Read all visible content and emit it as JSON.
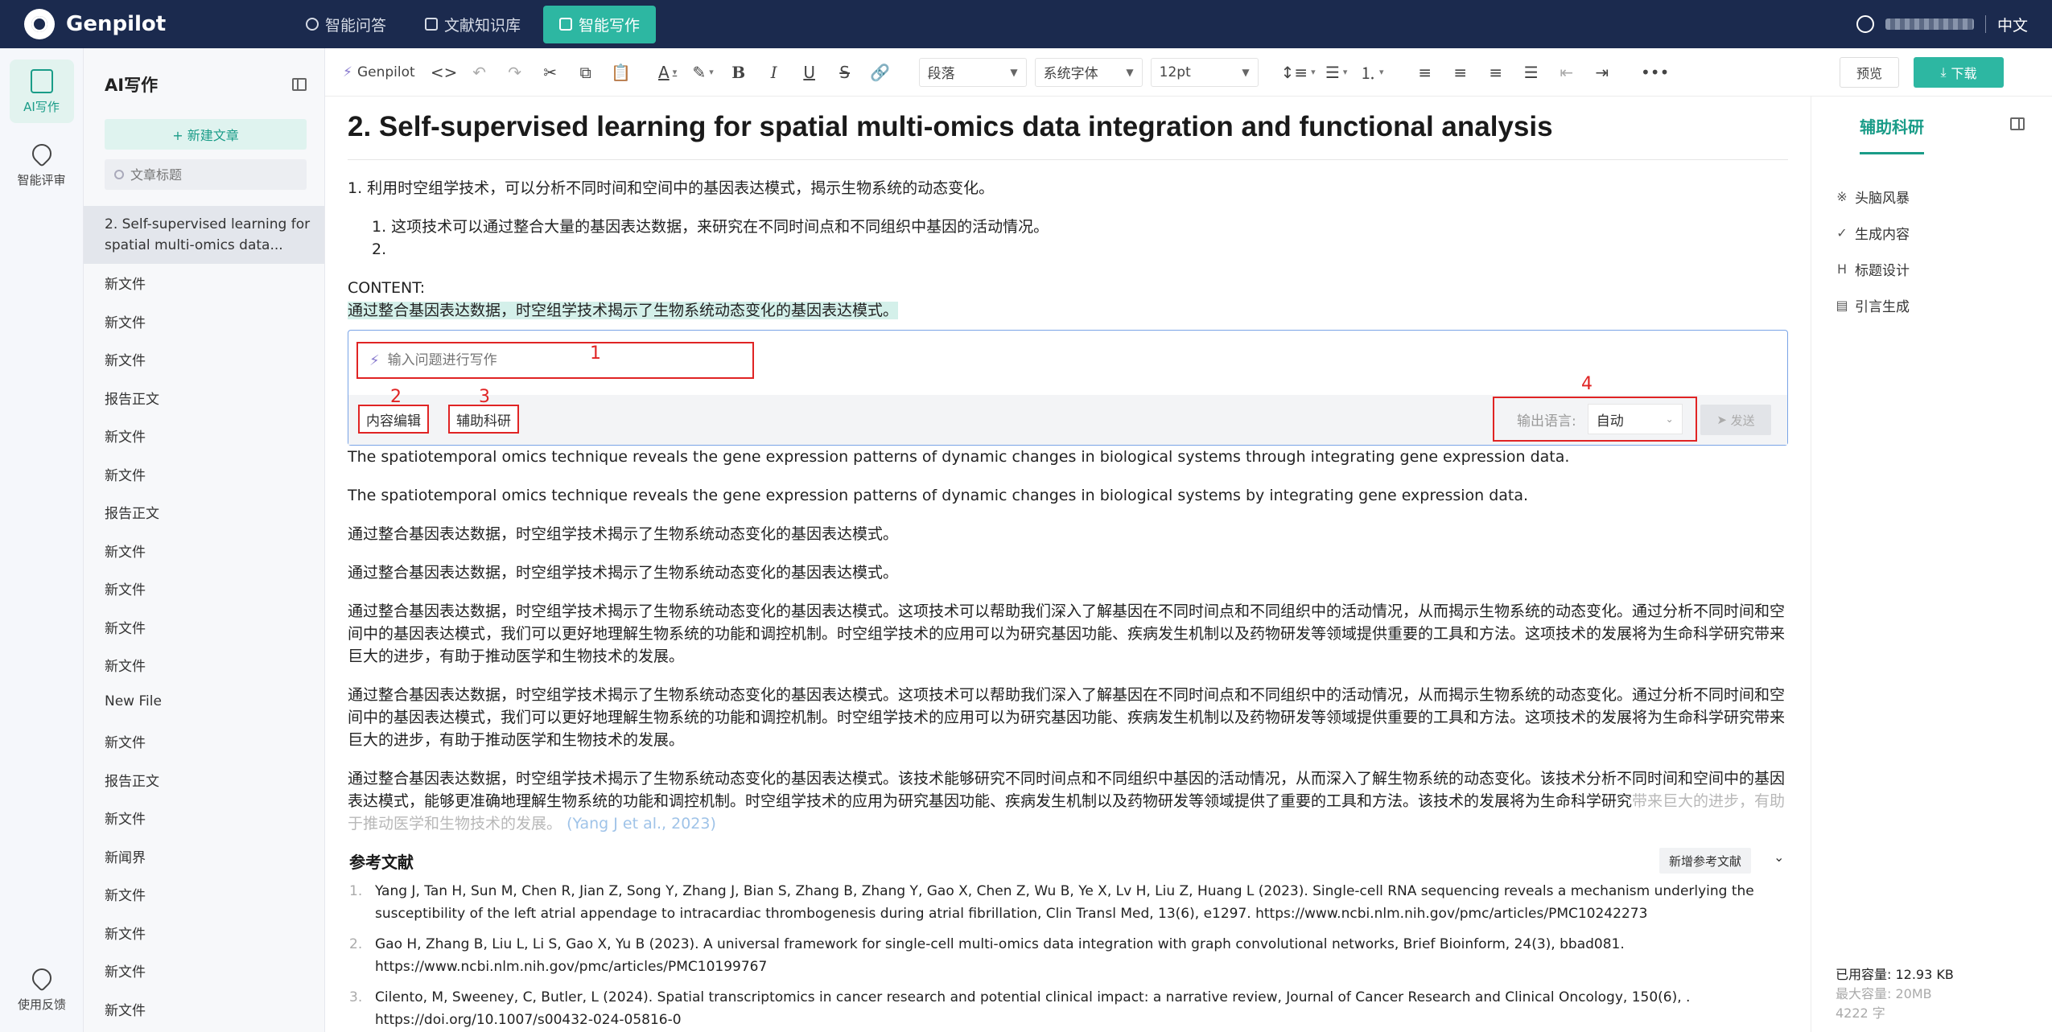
{
  "app": {
    "name": "Genpilot"
  },
  "nav": {
    "tabs": [
      {
        "label": "智能问答"
      },
      {
        "label": "文献知识库"
      },
      {
        "label": "智能写作"
      }
    ],
    "language": "中文"
  },
  "rail": {
    "items": [
      {
        "label": "AI写作"
      },
      {
        "label": "智能评审"
      }
    ],
    "feedback": "使用反馈"
  },
  "docpanel": {
    "title": "AI写作",
    "new_article": "+ 新建文章",
    "search_placeholder": "文章标题",
    "docs": [
      "2. Self-supervised learning for spatial multi-omics data...",
      "新文件",
      "新文件",
      "新文件",
      "报告正文",
      "新文件",
      "新文件",
      "报告正文",
      "新文件",
      "新文件",
      "新文件",
      "新文件",
      "New File",
      "新文件",
      "报告正文",
      "新文件",
      "新闻界",
      "新文件",
      "新文件",
      "新文件",
      "新文件"
    ]
  },
  "toolbar": {
    "genpilot": "Genpilot",
    "paragraph": "段落",
    "font": "系统字体",
    "size": "12pt",
    "preview": "预览",
    "download": "下载"
  },
  "editor": {
    "title": "2. Self-supervised learning for spatial multi-omics data integration and functional analysis",
    "p1": "1. 利用时空组学技术，可以分析不同时间和空间中的基因表达模式，揭示生物系统的动态变化。",
    "p1_sub1": "1. 这项技术可以通过整合大量的基因表达数据，来研究在不同时间点和不同组织中基因的活动情况。",
    "p1_sub2": "2.",
    "content_label": "CONTENT:",
    "highlighted": "通过整合基因表达数据，时空组学技术揭示了生物系统动态变化的基因表达模式。",
    "en1": "The spatiotemporal omics technique reveals the gene expression patterns of dynamic changes in biological systems through integrating gene expression data.",
    "en2": "The spatiotemporal omics technique reveals the gene expression patterns of dynamic changes in biological systems by integrating gene expression data.",
    "zh1": "通过整合基因表达数据，时空组学技术揭示了生物系统动态变化的基因表达模式。",
    "zh2": "通过整合基因表达数据，时空组学技术揭示了生物系统动态变化的基因表达模式。",
    "long1": "通过整合基因表达数据，时空组学技术揭示了生物系统动态变化的基因表达模式。这项技术可以帮助我们深入了解基因在不同时间点和不同组织中的活动情况，从而揭示生物系统的动态变化。通过分析不同时间和空间中的基因表达模式，我们可以更好地理解生物系统的功能和调控机制。时空组学技术的应用可以为研究基因功能、疾病发生机制以及药物研发等领域提供重要的工具和方法。这项技术的发展将为生命科学研究带来巨大的进步，有助于推动医学和生物技术的发展。",
    "long2": "通过整合基因表达数据，时空组学技术揭示了生物系统动态变化的基因表达模式。这项技术可以帮助我们深入了解基因在不同时间点和不同组织中的活动情况，从而揭示生物系统的动态变化。通过分析不同时间和空间中的基因表达模式，我们可以更好地理解生物系统的功能和调控机制。时空组学技术的应用可以为研究基因功能、疾病发生机制以及药物研发等领域提供重要的工具和方法。这项技术的发展将为生命科学研究带来巨大的进步，有助于推动医学和生物技术的发展。",
    "long3": "通过整合基因表达数据，时空组学技术揭示了生物系统动态变化的基因表达模式。该技术能够研究不同时间点和不同组织中基因的活动情况，从而深入了解生物系统的动态变化。该技术分析不同时间和空间中的基因表达模式，能够更准确地理解生物系统的功能和调控机制。时空组学技术的应用为研究基因功能、疾病发生机制以及药物研发等领域提供了重要的工具和方法。该技术的发展将为生命科学研究",
    "long3_faded": "带来巨大的进步，有助于推动医学和生物技术的发展。",
    "long3_cite": "(Yang J et al., 2023)"
  },
  "ai_box": {
    "placeholder": "输入问题进行写作",
    "chip_edit": "内容编辑",
    "chip_research": "辅助科研",
    "lang_label": "输出语言:",
    "lang_value": "自动",
    "send": "发送",
    "markers": [
      "1",
      "2",
      "3",
      "4"
    ]
  },
  "references": {
    "title": "参考文献",
    "add": "新增参考文献",
    "items": [
      {
        "n": "1.",
        "text": "Yang J, Tan H, Sun M, Chen R, Jian Z, Song Y, Zhang J, Bian S, Zhang B, Zhang Y, Gao X, Chen Z, Wu B, Ye X, Lv H, Liu Z, Huang L (2023). Single-cell RNA sequencing reveals a mechanism underlying the susceptibility of the left atrial appendage to intracardiac thrombogenesis during atrial fibrillation, Clin Transl Med, 13(6), e1297. https://www.ncbi.nlm.nih.gov/pmc/articles/PMC10242273"
      },
      {
        "n": "2.",
        "text": "Gao H, Zhang B, Liu L, Li S, Gao X, Yu B (2023). A universal framework for single-cell multi-omics data integration with graph convolutional networks, Brief Bioinform, 24(3), bbad081. https://www.ncbi.nlm.nih.gov/pmc/articles/PMC10199767"
      },
      {
        "n": "3.",
        "text": "Cilento, M, Sweeney, C, Butler, L (2024). Spatial transcriptomics in cancer research and potential clinical impact: a narrative review, Journal of Cancer Research and Clinical Oncology, 150(6), . https://doi.org/10.1007/s00432-024-05816-0"
      }
    ]
  },
  "rpanel": {
    "tab": "辅助科研",
    "items": [
      {
        "icon": "※",
        "label": "头脑风暴"
      },
      {
        "icon": "✓",
        "label": "生成内容"
      },
      {
        "icon": "H",
        "label": "标题设计"
      },
      {
        "icon": "▤",
        "label": "引言生成"
      }
    ],
    "used": "已用容量:  12.93 KB",
    "max": "最大容量:  20MB",
    "words": "4222 字"
  },
  "colors": {
    "accent": "#2db7a2",
    "topbar": "#1b2a4e",
    "annotation": "#e02424"
  }
}
